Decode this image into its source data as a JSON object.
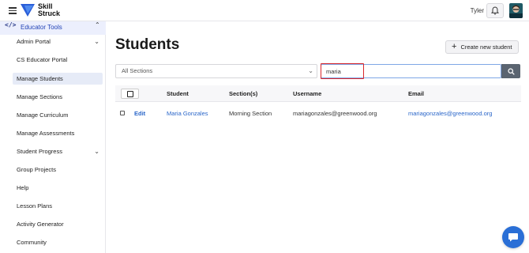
{
  "brand": {
    "line1": "Skill",
    "line2": "Struck"
  },
  "user": {
    "name": "Tyler"
  },
  "sidebar": {
    "header": {
      "code_icon": "</>",
      "label": "Educator Tools"
    },
    "items": [
      {
        "label": "Admin Portal",
        "chevron": "expand"
      },
      {
        "label": "CS Educator Portal"
      },
      {
        "label": "Manage Students",
        "active": true
      },
      {
        "label": "Manage Sections"
      },
      {
        "label": "Manage Curriculum"
      },
      {
        "label": "Manage Assessments"
      },
      {
        "label": "Student Progress",
        "chevron": "expand"
      },
      {
        "label": "Group Projects"
      },
      {
        "label": "Help"
      },
      {
        "label": "Lesson Plans"
      },
      {
        "label": "Activity Generator"
      },
      {
        "label": "Community"
      }
    ]
  },
  "main": {
    "title": "Students",
    "create_button": "Create new student",
    "section_filter": {
      "selected": "All Sections"
    },
    "search": {
      "value": "maria"
    },
    "table": {
      "headers": {
        "student": "Student",
        "sections": "Section(s)",
        "username": "Username",
        "email": "Email"
      },
      "rows": [
        {
          "action": "Edit",
          "student": "Maria Gonzales",
          "sections": "Morning Section",
          "username": "mariagonzales@greenwood.org",
          "email": "mariagonzales@greenwood.org"
        }
      ]
    }
  },
  "colors": {
    "accent": "#2a66c9",
    "highlight": "#d8262c",
    "chat": "#2a6fd6"
  },
  "icons": {
    "menu": "hamburger-icon",
    "logo": "skillstruck-logo",
    "notifications": "bell-icon",
    "search": "search-icon",
    "create": "plus-icon",
    "chat": "chat-bubble-icon"
  }
}
